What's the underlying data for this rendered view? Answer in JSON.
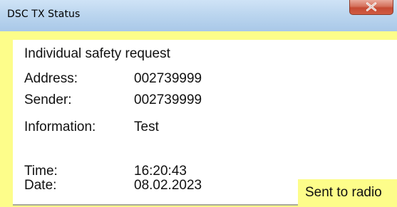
{
  "window": {
    "title": "DSC TX Status",
    "close_icon": "close-x-icon"
  },
  "message": {
    "heading": "Individual safety request",
    "fields": [
      {
        "label": "Address:",
        "value": "002739999"
      },
      {
        "label": "Sender:",
        "value": "002739999"
      },
      {
        "label": "Information:",
        "value": "Test"
      },
      {
        "label": "Time:",
        "value": "16:20:43"
      },
      {
        "label": "Date:",
        "value": "08.02.2023"
      }
    ]
  },
  "status": {
    "text": "Sent to radio"
  },
  "colors": {
    "background": "#fdfd8a",
    "content": "#ffffff",
    "titlebar": "#bcd6ef",
    "close_button": "#c54a33"
  }
}
